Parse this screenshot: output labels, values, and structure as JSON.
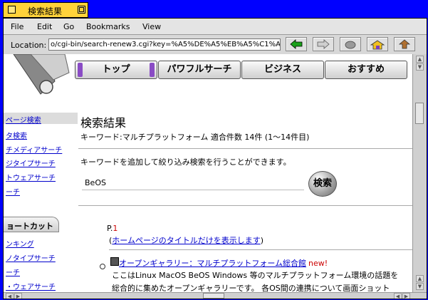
{
  "window": {
    "title": "検索結果"
  },
  "menu": [
    "File",
    "Edit",
    "Go",
    "Bookmarks",
    "View"
  ],
  "location": {
    "label": "Location:",
    "url": "o/cgi-bin/search-renew3.cgi?key=%A5%DE%A5%EB%A5%C1%A5%D"
  },
  "toolbar": {
    "icons": [
      "back-icon",
      "forward-icon",
      "stop-icon",
      "home-icon",
      "reload-icon"
    ]
  },
  "navtabs": [
    "トップ",
    "パワフルサーチ",
    "ビジネス",
    "おすすめ"
  ],
  "sidebar": {
    "top_items": [
      "ページ検索",
      "タ検索",
      "チメディアサーチ",
      "ジタイプサーチ",
      "トウェアサーチ",
      "ーチ"
    ],
    "section_title": "ョートカット",
    "shortcut_items": [
      "ンキング",
      "ノタイプサーチ",
      "ーチ",
      "・ウェアサーチ"
    ]
  },
  "main": {
    "heading": "検索結果",
    "keyword_line": "キーワード:マルチプラットフォーム 適合件数 14件 (1〜14件目)",
    "refine_text": "キーワードを追加して絞り込み検索を行うことができます。",
    "search_value": "BeOS",
    "search_button": "検索",
    "page_prefix": "P.",
    "page_number": "1",
    "paren_open": "(",
    "title_only_link": "ホームページのタイトルだけを表示します",
    "paren_close": ")",
    "result": {
      "title": "オープンギャラリー：マルチプラットフォーム総合館",
      "badge": "new!",
      "desc1": "ここはLinux MacOS BeOS Windows 等のマルチプラットフォーム環境の話題を",
      "desc2": "総合的に集めたオープンギャラリーです。 各OS間の連携について画面ショット"
    }
  },
  "colors": {
    "desktop": "#0000ff",
    "title_tab": "#ffd23a",
    "link": "#0000cc",
    "accent_red": "#cc0000"
  }
}
